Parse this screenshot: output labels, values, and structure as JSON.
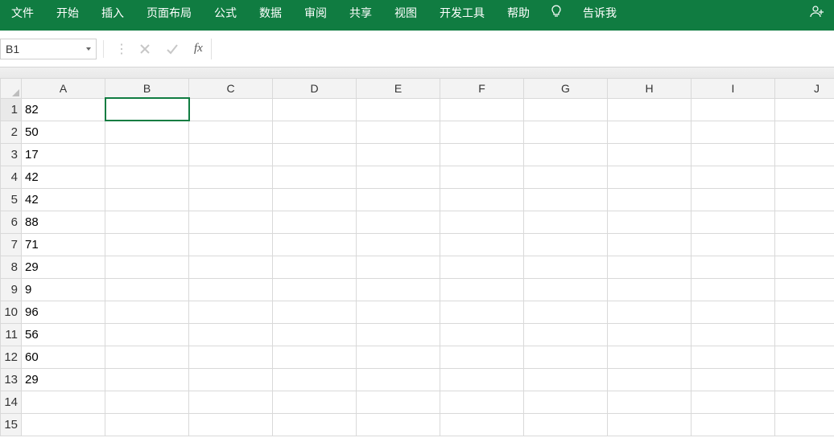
{
  "ribbon": {
    "tabs": {
      "file": "文件",
      "home": "开始",
      "insert": "插入",
      "layout": "页面布局",
      "formula": "公式",
      "data": "数据",
      "review": "审阅",
      "share": "共享",
      "view": "视图",
      "developer": "开发工具",
      "help": "帮助",
      "tellme": "告诉我"
    }
  },
  "namebox": {
    "value": "B1"
  },
  "formula": {
    "value": "",
    "fx": "fx"
  },
  "columns": [
    "A",
    "B",
    "C",
    "D",
    "E",
    "F",
    "G",
    "H",
    "I",
    "J"
  ],
  "rows": [
    "1",
    "2",
    "3",
    "4",
    "5",
    "6",
    "7",
    "8",
    "9",
    "10",
    "11",
    "12",
    "13",
    "14",
    "15"
  ],
  "cells": {
    "A1": "82",
    "A2": "50",
    "A3": "17",
    "A4": "42",
    "A5": "42",
    "A6": "88",
    "A7": "71",
    "A8": "29",
    "A9": "9",
    "A10": "96",
    "A11": "56",
    "A12": "60",
    "A13": "29"
  },
  "selection": {
    "cell": "B1",
    "col": "B",
    "row": "1"
  }
}
